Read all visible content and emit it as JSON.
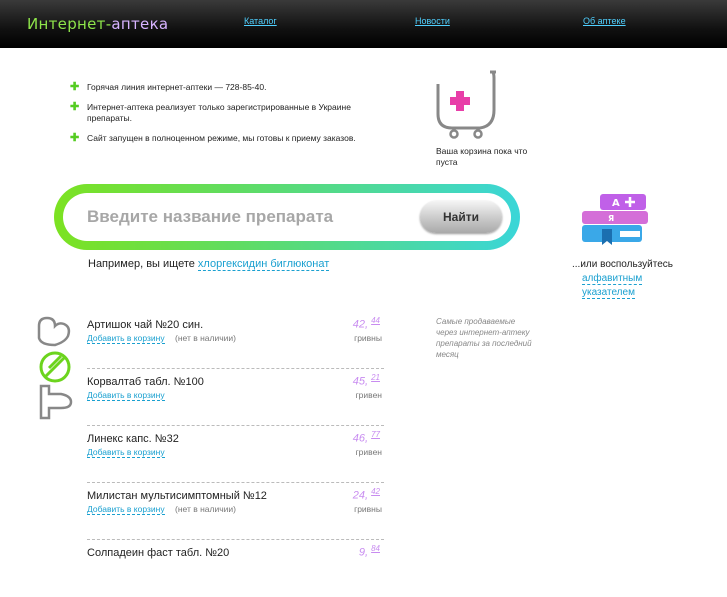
{
  "header": {
    "logo_part1": "Интернет-",
    "logo_part2": "аптека",
    "nav": [
      {
        "label": "Каталог"
      },
      {
        "label": "Новости"
      },
      {
        "label": "Об аптеке"
      }
    ]
  },
  "info": [
    "Горячая линия интернет-аптеки — 728-85-40.",
    "Интернет-аптека реализует только зарегистрированные в Украине препараты.",
    "Сайт запущен в полноценном режиме, мы готовы к приему заказов."
  ],
  "cart": {
    "text": "Ваша корзина пока что пуста"
  },
  "search": {
    "placeholder": "Введите название препарата",
    "button": "Найти",
    "example_prefix": "Например, вы ищете",
    "example_link": "хлоргексидин биглюконат"
  },
  "alphabet": {
    "prefix": "...или воспользуйтесь",
    "link_line1": "алфавитным",
    "link_line2": "указателем",
    "icon_letters": [
      "А",
      "Я"
    ]
  },
  "bestsellers_caption": "Самые продаваемые через интернет-аптеку препараты за последний месяц",
  "products": [
    {
      "name": "Артишок чай №20 син.",
      "add": "Добавить в корзину",
      "availability": "(нет в наличии)",
      "price_main": "42,",
      "price_cents": "44",
      "currency": "гривны"
    },
    {
      "name": "Корвалтаб табл. №100",
      "add": "Добавить в корзину",
      "availability": "",
      "price_main": "45,",
      "price_cents": "21",
      "currency": "гривен"
    },
    {
      "name": "Линекс капс. №32",
      "add": "Добавить в корзину",
      "availability": "",
      "price_main": "46,",
      "price_cents": "77",
      "currency": "гривен"
    },
    {
      "name": "Милистан мультисимптомный №12",
      "add": "Добавить в корзину",
      "availability": "(нет в наличии)",
      "price_main": "24,",
      "price_cents": "42",
      "currency": "гривны"
    },
    {
      "name": "Солпадеин фаст табл. №20",
      "add": "",
      "availability": "",
      "price_main": "9,",
      "price_cents": "84",
      "currency": ""
    }
  ],
  "colors": {
    "accent_green": "#7ce221",
    "accent_cyan": "#3ad6d8",
    "accent_purple": "#c88cf0",
    "link_blue": "#1aa0d0"
  }
}
